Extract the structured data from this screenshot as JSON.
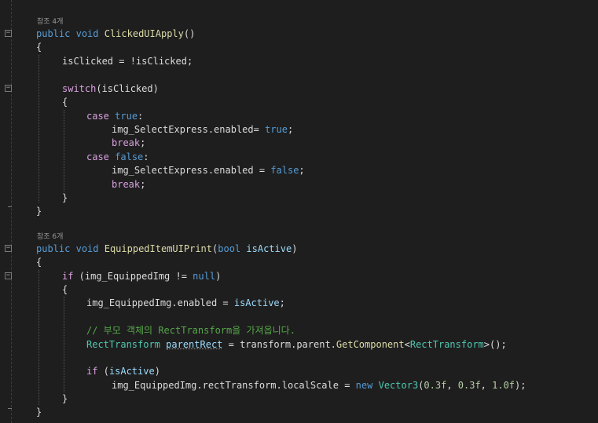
{
  "codelens": {
    "refs1": "참조 4개",
    "refs2": "참조 6개"
  },
  "code": {
    "l1": {
      "kw1": "public",
      "kw2": "void",
      "name": "ClickedUIApply",
      "rest": "()"
    },
    "l2": {
      "text": "{"
    },
    "l3": {
      "text": "isClicked = !isClicked;"
    },
    "l5": {
      "kw": "switch",
      "rest": "(isClicked)"
    },
    "l6": {
      "text": "{"
    },
    "l7": {
      "kw": "case",
      "val": "true",
      "rest": ":"
    },
    "l8": {
      "text": "img_SelectExpress.enabled= ",
      "val": "true",
      "rest": ";"
    },
    "l9": {
      "kw": "break",
      "rest": ";"
    },
    "l10": {
      "kw": "case",
      "val": "false",
      "rest": ":"
    },
    "l11": {
      "text": "img_SelectExpress.enabled = ",
      "val": "false",
      "rest": ";"
    },
    "l12": {
      "kw": "break",
      "rest": ";"
    },
    "l13": {
      "text": "}"
    },
    "l14": {
      "text": "}"
    },
    "l15": {
      "kw1": "public",
      "kw2": "void",
      "name": "EquippedItemUIPrint",
      "open": "(",
      "type": "bool",
      "param": "isActive",
      "close": ")"
    },
    "l16": {
      "text": "{"
    },
    "l17": {
      "kw": "if",
      "text": " (img_EquippedImg != ",
      "val": "null",
      "rest": ")"
    },
    "l18": {
      "text": "{"
    },
    "l19": {
      "text": "img_EquippedImg.enabled = ",
      "param": "isActive",
      "rest": ";"
    },
    "l20": {
      "comment": "// 부모 객체의 RectTransform을 가져옵니다."
    },
    "l21": {
      "type": "RectTransform",
      "sp": " ",
      "var": "parentRect",
      "mid": " = transform.parent.",
      "method": "GetComponent",
      "lt": "<",
      "type2": "RectTransform",
      "end": ">();"
    },
    "l22": {
      "kw": "if",
      "open": " (",
      "param": "isActive",
      "close": ")"
    },
    "l23": {
      "text": "img_EquippedImg.rectTransform.localScale = ",
      "kw": "new",
      "sp": " ",
      "type": "Vector3",
      "open": "(",
      "n1": "0.3f",
      "c1": ", ",
      "n2": "0.3f",
      "c2": ", ",
      "n3": "1.0f",
      "end": ");"
    },
    "l24": {
      "text": "}"
    },
    "l25": {
      "text": "}"
    }
  },
  "colors": {
    "background": "#1e1e1e",
    "keyword": "#569cd6",
    "control": "#d8a0df",
    "method": "#dcdcaa",
    "type": "#4ec9b0",
    "parameter": "#9cdcfe",
    "number": "#b5cea8",
    "comment": "#57a64a",
    "text": "#dcdcdc"
  },
  "icons": [
    "fold-minus-icon"
  ]
}
